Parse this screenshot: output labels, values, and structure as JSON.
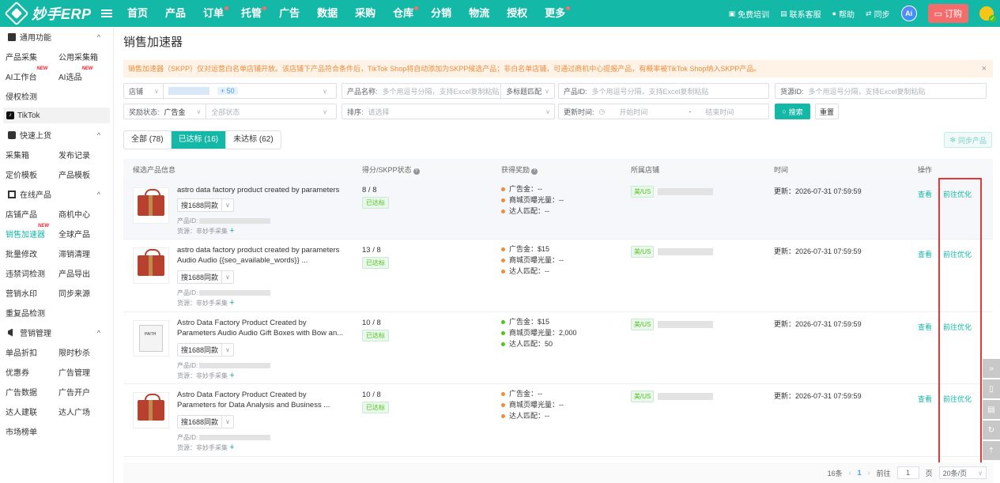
{
  "brand": {
    "name": "妙手ERP",
    "accent": "#14b8a6"
  },
  "nav": [
    {
      "label": "首页",
      "dot": false
    },
    {
      "label": "产品",
      "dot": false
    },
    {
      "label": "订单",
      "dot": true
    },
    {
      "label": "托管",
      "dot": true
    },
    {
      "label": "广告",
      "dot": false
    },
    {
      "label": "数据",
      "dot": false
    },
    {
      "label": "采购",
      "dot": false
    },
    {
      "label": "仓库",
      "dot": true
    },
    {
      "label": "分销",
      "dot": false
    },
    {
      "label": "物流",
      "dot": false
    },
    {
      "label": "授权",
      "dot": false
    },
    {
      "label": "更多",
      "dot": true
    }
  ],
  "top_right": {
    "training": "免费培训",
    "support": "联系客服",
    "help": "帮助",
    "sync": "同步",
    "ai": "Ai",
    "order": "订购"
  },
  "sidebar": {
    "general": {
      "title": "通用功能",
      "items": [
        "产品采集",
        "公用采集箱",
        "AI工作台",
        "AI选品",
        "侵权检测"
      ],
      "new_badges": [
        "NEW",
        "NEW"
      ]
    },
    "platform": "TikTok",
    "quick": {
      "title": "快速上货",
      "items": [
        "采集箱",
        "发布记录",
        "定价模板",
        "产品模板"
      ]
    },
    "online": {
      "title": "在线产品",
      "items": [
        "店铺产品",
        "商机中心",
        "销售加速器",
        "全球产品",
        "批量修改",
        "滞销清理",
        "违禁词检测",
        "产品导出",
        "营销水印",
        "同步来源",
        "重复品检测"
      ],
      "new_badge": "NEW"
    },
    "marketing": {
      "title": "营销管理",
      "items": [
        "单品折扣",
        "限时秒杀",
        "优惠券",
        "广告管理",
        "广告数据",
        "广告开户",
        "达人建联",
        "达人广场",
        "市场榜单"
      ]
    }
  },
  "page": {
    "title": "销售加速器",
    "notice": "销售加速器（SKPP）仅对运营白名单店铺开放。该店铺下产品符合条件后，TikTok Shop将自动添加为SKPP候选产品；非白名单店铺，可通过商机中心提报产品，有概率被TikTok Shop纳入SKPP产品。",
    "close": "×"
  },
  "filters": {
    "shop_label": "店铺",
    "shop_count": "+ 50",
    "name_label": "产品名称:",
    "name_placeholder": "多个用逗号分隔，支持Excel复制粘贴",
    "match_mode": "多标题匹配",
    "pid_label": "产品ID:",
    "pid_placeholder": "多个用逗号分隔，支持Excel复制粘贴",
    "src_label": "货源ID:",
    "src_placeholder": "多个用逗号分隔，支持Excel复制粘贴",
    "reward_label": "奖励状态:",
    "reward_value": "广告金",
    "status_placeholder": "全部状态",
    "sort_label": "排序:",
    "sort_placeholder": "请选择",
    "time_label": "更新时间:",
    "start_placeholder": "开始时间",
    "dash": "-",
    "end_placeholder": "结束时间",
    "search": "搜索",
    "reset": "重置"
  },
  "tabs": [
    {
      "label": "全部 (78)",
      "active": false
    },
    {
      "label": "已达标 (16)",
      "active": true
    },
    {
      "label": "未达标 (62)",
      "active": false
    }
  ],
  "sync_button": "同步产品",
  "table": {
    "headers": {
      "product": "候选产品信息",
      "score": "得分/SKPP状态",
      "reward": "获得奖励",
      "shop": "所属店铺",
      "time": "时间",
      "action": "操作"
    },
    "rows": [
      {
        "title": "astro data factory product created by parameters",
        "thumb": "gift",
        "btn": "搜1688同款",
        "pid_label": "产品ID:",
        "source": "货源：非妙手采集",
        "score": "8 / 8",
        "status": "已达标",
        "rewards": [
          {
            "label": "广告金：--",
            "color": "#f08c3a"
          },
          {
            "label": "商城页曝光量：--",
            "color": "#f08c3a"
          },
          {
            "label": "达人匹配：--",
            "color": "#f08c3a"
          }
        ],
        "region": "美/US",
        "time": "更新：2026-07-31 07:59:59",
        "view": "查看",
        "optimize": "前往优化"
      },
      {
        "title": "astro data factory product created by parameters Audio Audio {{seo_available_words}} ...",
        "thumb": "gift",
        "btn": "搜1688同款",
        "pid_label": "产品ID:",
        "source": "货源：非妙手采集",
        "score": "13 / 8",
        "status": "已达标",
        "rewards": [
          {
            "label": "广告金：$15",
            "color": "#f08c3a"
          },
          {
            "label": "商城页曝光量：--",
            "color": "#f08c3a"
          },
          {
            "label": "达人匹配：--",
            "color": "#f08c3a"
          }
        ],
        "region": "美/US",
        "time": "更新：2026-07-31 07:59:59",
        "view": "查看",
        "optimize": "前往优化"
      },
      {
        "title": "Astro Data Factory Product Created by Parameters Audio Audio Gift Boxes with Bow an...",
        "thumb": "shirt",
        "btn": "搜1688同款",
        "pid_label": "产品ID:",
        "source": "货源：非妙手采集",
        "score": "10 / 8",
        "status": "已达标",
        "rewards": [
          {
            "label": "广告金：$15",
            "color": "#52c41a"
          },
          {
            "label": "商城页曝光量：2,000",
            "color": "#52c41a"
          },
          {
            "label": "达人匹配：50",
            "color": "#52c41a"
          }
        ],
        "region": "美/US",
        "time": "更新：2026-07-31 07:59:59",
        "view": "查看",
        "optimize": "前往优化"
      },
      {
        "title": "Astro Data Factory Product Created by Parameters for Data Analysis and Business ...",
        "thumb": "gift",
        "btn": "搜1688同款",
        "pid_label": "产品ID:",
        "source": "货源：非妙手采集",
        "score": "10 / 8",
        "status": "已达标",
        "rewards": [
          {
            "label": "广告金：--",
            "color": "#f08c3a"
          },
          {
            "label": "商城页曝光量：--",
            "color": "#f08c3a"
          },
          {
            "label": "达人匹配：--",
            "color": "#f08c3a"
          }
        ],
        "region": "美/US",
        "time": "更新：2026-07-31 07:59:59",
        "view": "查看",
        "optimize": "前往优化"
      }
    ]
  },
  "pager": {
    "total": "16条",
    "prev": "‹",
    "page": "1",
    "next": "›",
    "goto": "前往",
    "input": "1",
    "page_unit": "页",
    "size": "20条/页"
  }
}
